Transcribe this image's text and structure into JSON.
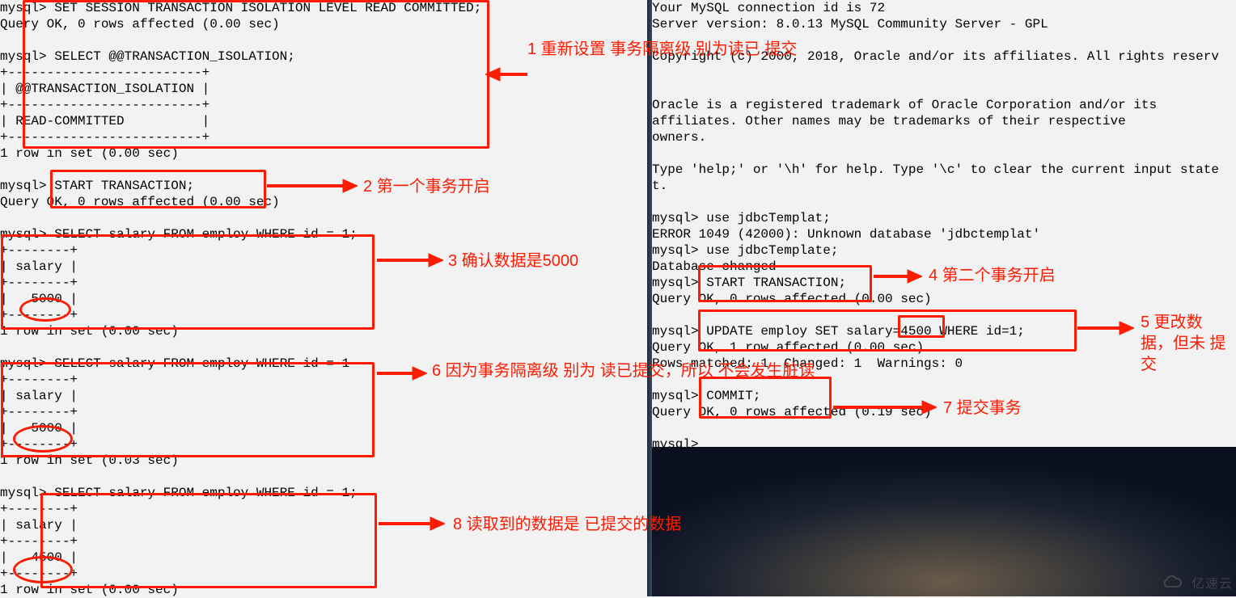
{
  "left_terminal": "mysql> SET SESSION TRANSACTION ISOLATION LEVEL READ COMMITTED;\nQuery OK, 0 rows affected (0.00 sec)\n\nmysql> SELECT @@TRANSACTION_ISOLATION;\n+-------------------------+\n| @@TRANSACTION_ISOLATION |\n+-------------------------+\n| READ-COMMITTED          |\n+-------------------------+\n1 row in set (0.00 sec)\n\nmysql> START TRANSACTION;\nQuery OK, 0 rows affected (0.00 sec)\n\nmysql> SELECT salary FROM employ WHERE id = 1;\n+--------+\n| salary |\n+--------+\n|   5000 |\n+--------+\n1 row in set (0.00 sec)\n\nmysql> SELECT salary FROM employ WHERE id = 1\n+--------+\n| salary |\n+--------+\n|   5000 |\n+--------+\n1 row in set (0.03 sec)\n\nmysql> SELECT salary FROM employ WHERE id = 1;\n+--------+\n| salary |\n+--------+\n|   4500 |\n+--------+\n1 row in set (0.00 sec)",
  "right_terminal": "Your MySQL connection id is 72\nServer version: 8.0.13 MySQL Community Server - GPL\n\nCopyright (c) 2000, 2018, Oracle and/or its affiliates. All rights reserv\n\n\nOracle is a registered trademark of Oracle Corporation and/or its\naffiliates. Other names may be trademarks of their respective\nowners.\n\nType 'help;' or '\\h' for help. Type '\\c' to clear the current input state\nt.\n\nmysql> use jdbcTemplat;\nERROR 1049 (42000): Unknown database 'jdbctemplat'\nmysql> use jdbcTemplate;\nDatabase changed\nmysql> START TRANSACTION;\nQuery OK, 0 rows affected (0.00 sec)\n\nmysql> UPDATE employ SET salary=4500 WHERE id=1;\nQuery OK, 1 row affected (0.00 sec)\nRows matched: 1  Changed: 1  Warnings: 0\n\nmysql> COMMIT;\nQuery OK, 0 rows affected (0.19 sec)\n\nmysql>",
  "annotations": {
    "a1": "1 重新设置\n事务隔离级\n别为读已\n提交",
    "a2": "2 第一个事务开启",
    "a3": "3 确认数据是5000",
    "a4": "4 第二个事务开启",
    "a5": "5 更改数\n据，但未\n提交",
    "a6": "6 因为事务隔离级\n别为 读已提交，所以\n不会发生脏读",
    "a7": "7 提交事务",
    "a8": "8 读取到的数据是\n已提交的数据"
  },
  "watermark": "亿速云"
}
